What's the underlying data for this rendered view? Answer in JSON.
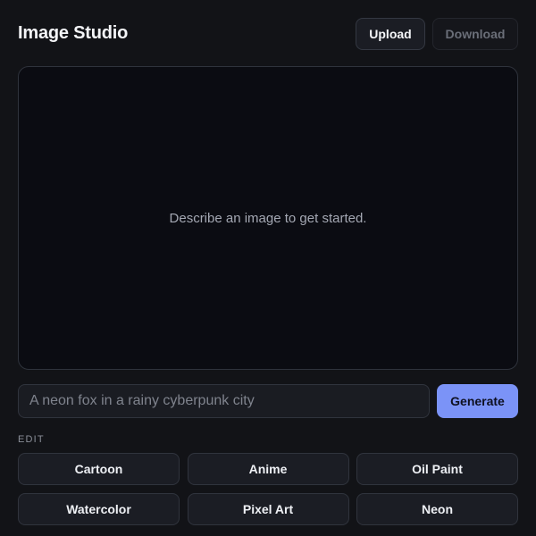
{
  "header": {
    "title": "Image Studio",
    "upload_label": "Upload",
    "download_label": "Download"
  },
  "canvas": {
    "hint": "Describe an image to get started."
  },
  "prompt": {
    "placeholder": "A neon fox in a rainy cyberpunk city",
    "value": "",
    "generate_label": "Generate"
  },
  "edit": {
    "section_label": "EDIT",
    "effects": [
      {
        "label": "Cartoon"
      },
      {
        "label": "Anime"
      },
      {
        "label": "Oil Paint"
      },
      {
        "label": "Watercolor"
      },
      {
        "label": "Pixel Art"
      },
      {
        "label": "Neon"
      }
    ]
  },
  "colors": {
    "background": "#121317",
    "canvas": "#0b0c12",
    "accent": "#7b93f7",
    "disabled_text": "#6a6e78"
  }
}
